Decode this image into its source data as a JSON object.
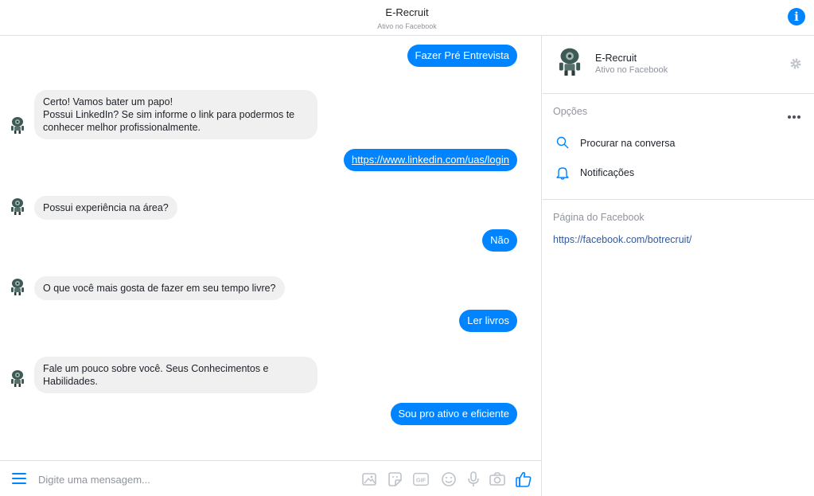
{
  "header": {
    "title": "E-Recruit",
    "subtitle": "Ativo no Facebook",
    "info_icon": "info-icon"
  },
  "messages": [
    {
      "from": "user",
      "text": "Fazer Pré Entrevista"
    },
    {
      "from": "bot",
      "text": "Certo! Vamos bater um papo!\nPossui LinkedIn? Se sim informe o link para podermos te conhecer melhor profissionalmente."
    },
    {
      "from": "user",
      "text": "https://www.linkedin.com/uas/login",
      "is_link": true
    },
    {
      "from": "bot",
      "text": "Possui experiência na área?"
    },
    {
      "from": "user",
      "text": "Não"
    },
    {
      "from": "bot",
      "text": "O que você mais gosta de fazer em seu tempo livre?"
    },
    {
      "from": "user",
      "text": "Ler livros"
    },
    {
      "from": "bot",
      "text": "Fale um pouco sobre você. Seus Conhecimentos e Habilidades."
    },
    {
      "from": "user",
      "text": "Sou pro ativo e eficiente"
    }
  ],
  "composer": {
    "placeholder": "Digite uma mensagem...",
    "tools": [
      "photo-icon",
      "sticker-icon",
      "gif-icon",
      "emoji-icon",
      "microphone-icon",
      "camera-icon",
      "like-icon"
    ]
  },
  "sidebar": {
    "name": "E-Recruit",
    "status": "Ativo no Facebook",
    "options_title": "Opções",
    "options": [
      {
        "label": "Procurar na conversa",
        "icon": "search-icon"
      },
      {
        "label": "Notificações",
        "icon": "bell-icon"
      }
    ],
    "page_title": "Página do Facebook",
    "page_link": "https://facebook.com/botrecruit/"
  },
  "colors": {
    "accent": "#0084ff",
    "bot_bubble": "#f1f0f0",
    "muted": "#90949c",
    "link": "#365899"
  }
}
